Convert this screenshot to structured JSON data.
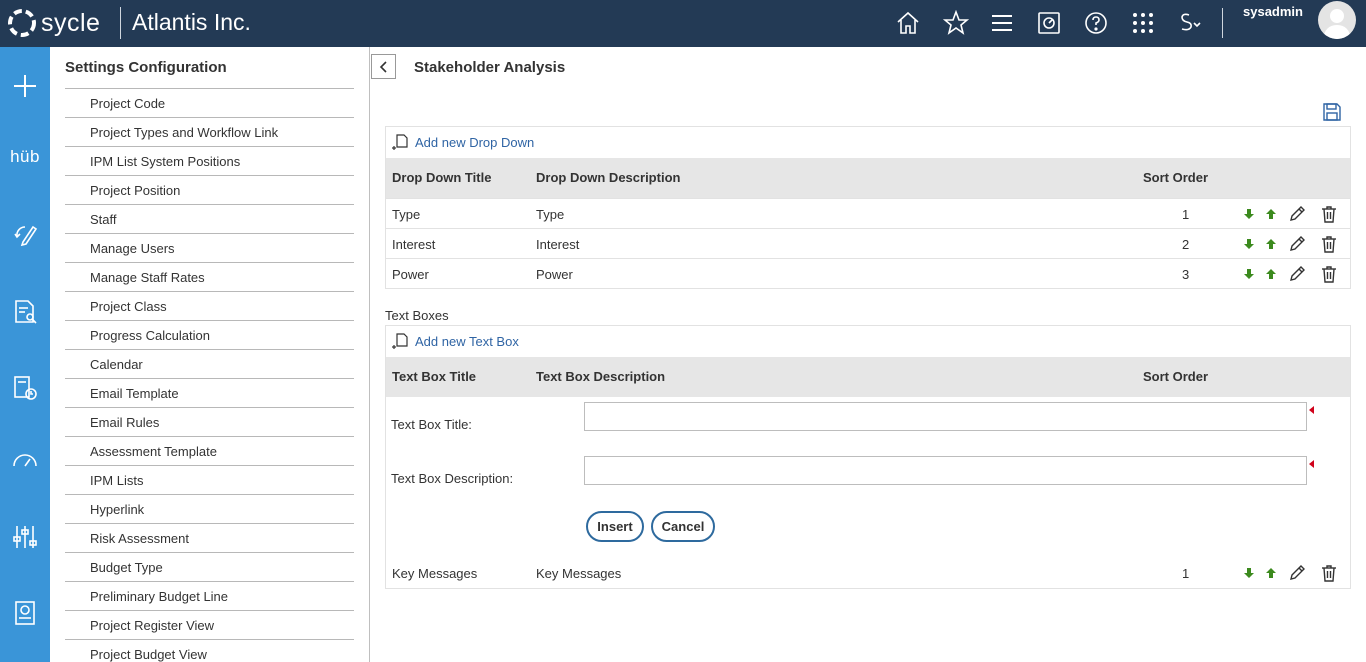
{
  "header": {
    "brand": "sycle",
    "company": "Atlantis Inc.",
    "username": "sysadmin",
    "icons": [
      "home-icon",
      "star-icon",
      "menu-icon",
      "dashboard-icon",
      "help-icon",
      "apps-grid-icon",
      "s-dropdown-icon"
    ],
    "s_menu_label": "S"
  },
  "rail": {
    "items": [
      "plus-icon",
      "hub",
      "refresh-edit-icon",
      "document-search-icon",
      "calculator-clock-icon",
      "gauge-icon",
      "sliders-icon",
      "report-icon"
    ],
    "hub_label": "hüb"
  },
  "settings": {
    "title": "Settings Configuration",
    "items": [
      "Project Code",
      "Project Types and Workflow Link",
      "IPM List System Positions",
      "Project Position",
      "Staff",
      "Manage Users",
      "Manage Staff Rates",
      "Project Class",
      "Progress Calculation",
      "Calendar",
      "Email Template",
      "Email Rules",
      "Assessment Template",
      "IPM Lists",
      "Hyperlink",
      "Risk Assessment",
      "Budget Type",
      "Preliminary Budget Line",
      "Project Register View",
      "Project Budget View"
    ]
  },
  "main": {
    "title": "Stakeholder Analysis",
    "dropdowns": {
      "add_label": "Add new Drop Down",
      "headers": {
        "title": "Drop Down Title",
        "description": "Drop Down Description",
        "sort": "Sort Order"
      },
      "rows": [
        {
          "title": "Type",
          "description": "Type",
          "sort": "1"
        },
        {
          "title": "Interest",
          "description": "Interest",
          "sort": "2"
        },
        {
          "title": "Power",
          "description": "Power",
          "sort": "3"
        }
      ]
    },
    "textboxes": {
      "section_label": "Text Boxes",
      "add_label": "Add new Text Box",
      "headers": {
        "title": "Text Box Title",
        "description": "Text Box Description",
        "sort": "Sort Order"
      },
      "form": {
        "title_label": "Text Box Title:",
        "title_value": "",
        "description_label": "Text Box Description:",
        "description_value": "",
        "insert_label": "Insert",
        "cancel_label": "Cancel"
      },
      "rows": [
        {
          "title": "Key Messages",
          "description": "Key Messages",
          "sort": "1"
        }
      ]
    }
  },
  "colors": {
    "topbar": "#233a55",
    "rail": "#3a95d8",
    "link": "#2f64a4",
    "arrow_green": "#3c8a1e",
    "required": "#d0021b"
  }
}
